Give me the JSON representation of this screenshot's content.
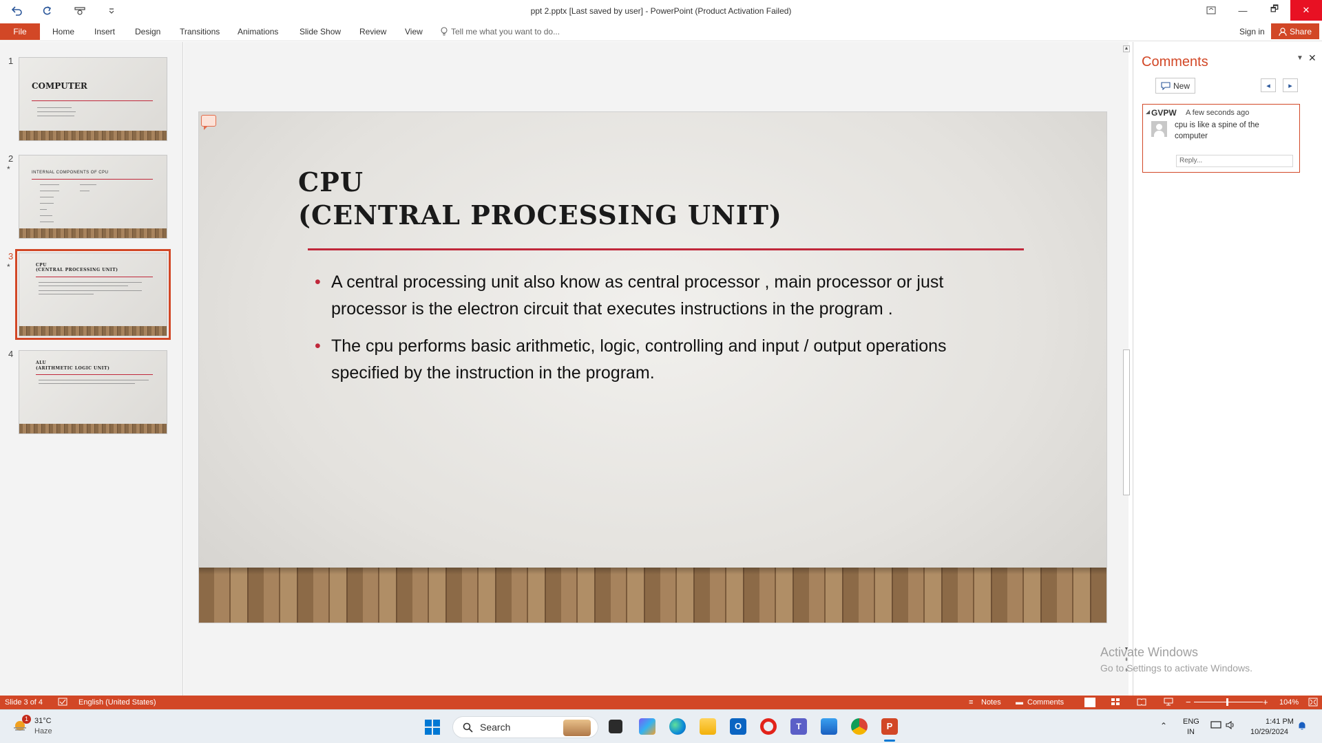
{
  "titlebar": {
    "title": "ppt 2.pptx [Last saved by user] - PowerPoint (Product Activation Failed)",
    "qat": [
      "undo-icon",
      "redo-icon",
      "touch-mode-icon",
      "customize-qat-icon"
    ],
    "window_buttons": [
      "ribbon-display-icon",
      "minimize-icon",
      "restore-icon",
      "close-icon"
    ],
    "restore_glyph": "🗗",
    "close_glyph": "✕",
    "minimize_glyph": "—"
  },
  "ribbon": {
    "file": "File",
    "tabs": [
      "Home",
      "Insert",
      "Design",
      "Transitions",
      "Animations",
      "Slide Show",
      "Review",
      "View"
    ],
    "tell_me": "Tell me what you want to do...",
    "sign_in": "Sign in",
    "share": "Share"
  },
  "thumbnails": [
    {
      "number": "1",
      "star": "",
      "title": "COMPUTER"
    },
    {
      "number": "2",
      "star": "*",
      "title": "INTERNAL COMPONENTS OF CPU"
    },
    {
      "number": "3",
      "star": "*",
      "title": "CPU\n(CENTRAL PROCESSING UNIT)"
    },
    {
      "number": "4",
      "star": "",
      "title": "ALU\n(ARITHMETIC LOGIC UNIT)"
    }
  ],
  "slide": {
    "title_line1": "CPU",
    "title_line2": "(CENTRAL PROCESSING UNIT)",
    "bullets": [
      "A central processing unit also know as central processor , main processor or just processor is the electron circuit that executes instructions in the program .",
      "The cpu performs basic arithmetic, logic, controlling  and input / output operations specified by the instruction in the program."
    ]
  },
  "comments": {
    "title": "Comments",
    "new_label": "New",
    "author": "GVPW",
    "time": "A few seconds ago",
    "text": "cpu is like a spine of the computer",
    "reply_placeholder": "Reply..."
  },
  "watermark": {
    "line1": "Activate Windows",
    "line2": "Go to Settings to activate Windows."
  },
  "statusbar": {
    "slide_info": "Slide 3 of 4",
    "language": "English (United States)",
    "notes": "Notes",
    "comments": "Comments",
    "zoom": "104%",
    "zoom_minus": "−",
    "zoom_plus": "+"
  },
  "taskbar": {
    "weather_temp": "31°C",
    "weather_desc": "Haze",
    "weather_badge": "1",
    "search": "Search",
    "lang1": "ENG",
    "lang2": "IN",
    "time": "1:41 PM",
    "date": "10/29/2024"
  },
  "colors": {
    "accent": "#d24726",
    "title_rule": "#c0273a"
  }
}
